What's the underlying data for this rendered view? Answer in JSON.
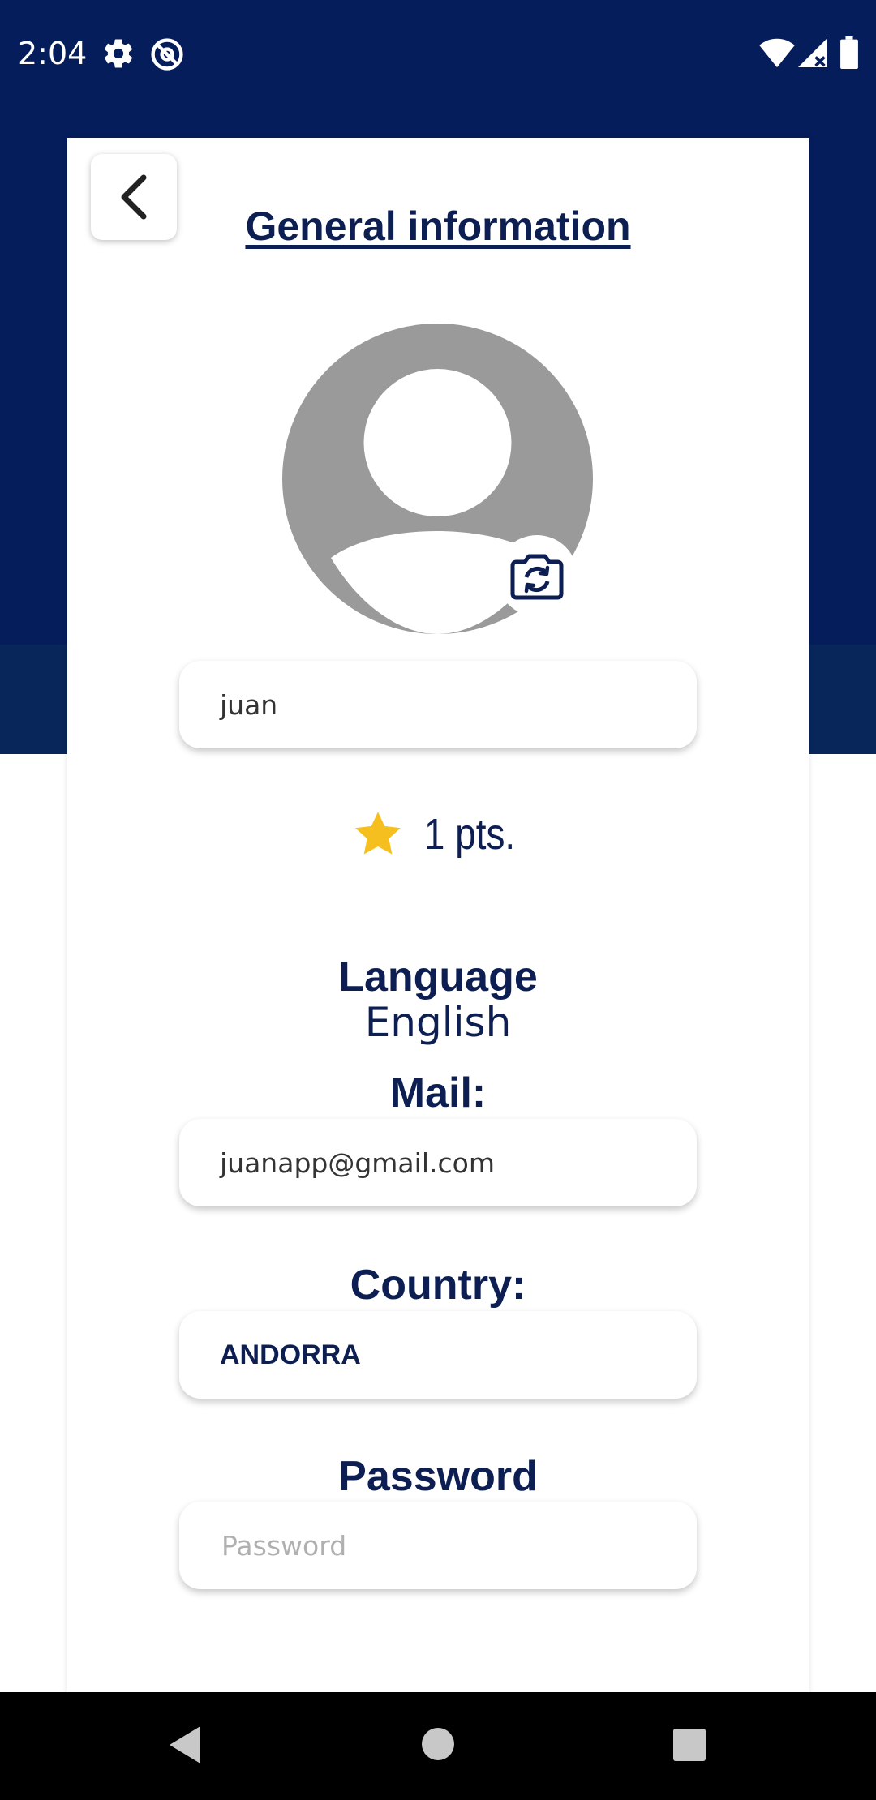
{
  "status_bar": {
    "time": "2:04",
    "icons": [
      "gear-icon",
      "at-sign-icon",
      "wifi-icon",
      "signal-icon",
      "battery-icon"
    ]
  },
  "header": {
    "back_icon": "chevron-left-icon",
    "title": "General information"
  },
  "profile": {
    "avatar_icon": "avatar-placeholder-icon",
    "change_photo_icon": "camera-switch-icon",
    "name_value": "juan",
    "points_icon": "star-icon",
    "points_text": "1 pts."
  },
  "language": {
    "label": "Language",
    "value": "English"
  },
  "mail": {
    "label": "Mail:",
    "value": "juanapp@gmail.com"
  },
  "country": {
    "label": "Country:",
    "value": "ANDORRA"
  },
  "password": {
    "label": "Password",
    "placeholder": "Password",
    "value": ""
  },
  "nav_bar": {
    "icons": [
      "back-triangle-icon",
      "home-circle-icon",
      "recents-square-icon"
    ]
  },
  "colors": {
    "header_bg": "#061d5c",
    "text_primary": "#0d1f52",
    "star": "#f5c01f",
    "avatar_gray": "#9a9a9a"
  }
}
